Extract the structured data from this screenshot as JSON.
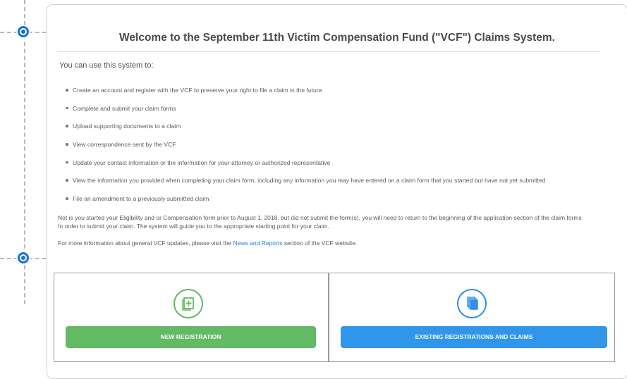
{
  "colors": {
    "accent_green": "#64b964",
    "accent_blue": "#2f96ea",
    "link": "#1a7fe0",
    "guide_node": "#1a6fd4"
  },
  "icons": {
    "new_registration": "add-document-icon",
    "existing_registrations": "documents-stack-icon",
    "guide_nodes": "target-node-icon"
  },
  "page": {
    "title": "Welcome to the September 11th Victim Compensation Fund (\"VCF\") Claims System.",
    "intro": "You can use this system to:",
    "capabilities": [
      "Create an account and register with the VCF to preserve your right to file a claim in the future",
      "Complete and submit your claim forms",
      "Upload supporting documents to a claim",
      "View correspondence sent by the VCF",
      "Update your contact information or the information for your attorney or authorized representative",
      "View the information you provided when completing your claim form, including any information you may have entered on a claim form that you started but have not yet submitted",
      "File an amendment to a previously submitted claim"
    ],
    "note_line1": "Not is you started your Eligibility and or Compensation form prior to August 1, 2018, but did not submit the form(s), you will need to return to the beginning of the application section of the claim forms",
    "note_line2": "In order to submit your claim. The system will guide you to the appropriate starting point for your claim.",
    "more_info_prefix": "For more information about general VCF updates, please visit the ",
    "more_info_link": "News and Reports",
    "more_info_suffix": " section of the VCF website."
  },
  "actions": {
    "new_registration_label": "NEW REGISTRATION",
    "existing_label": "EXISTING REGISTRATIONS AND CLAIMS"
  }
}
